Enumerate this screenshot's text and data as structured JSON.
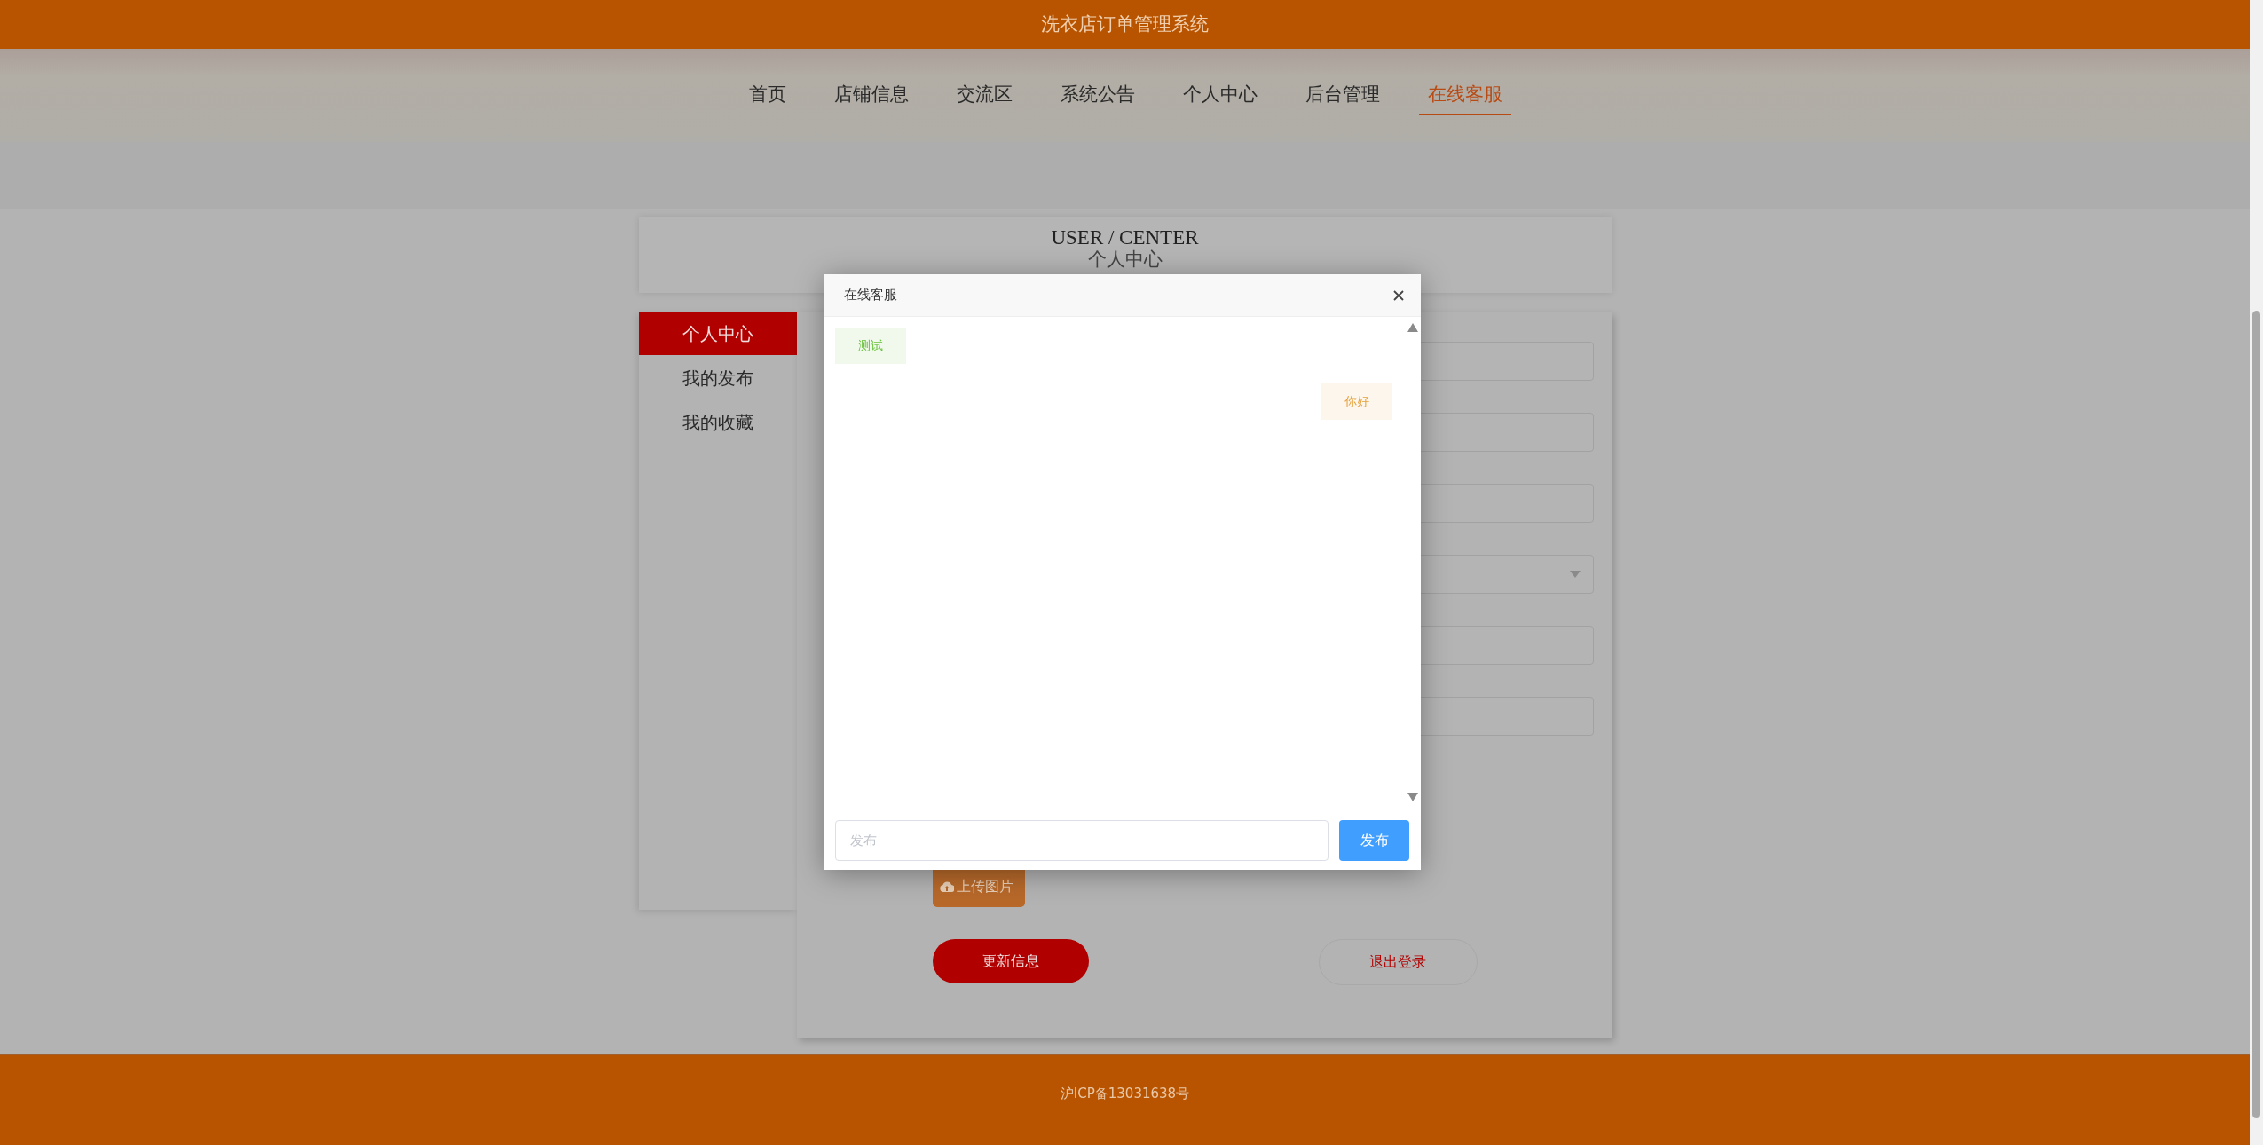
{
  "header": {
    "title": "洗衣店订单管理系统"
  },
  "nav": [
    {
      "label": "首页",
      "selected": false
    },
    {
      "label": "店铺信息",
      "selected": false
    },
    {
      "label": "交流区",
      "selected": false
    },
    {
      "label": "系统公告",
      "selected": false
    },
    {
      "label": "个人中心",
      "selected": false
    },
    {
      "label": "后台管理",
      "selected": false
    },
    {
      "label": "在线客服",
      "selected": true
    }
  ],
  "banner": {
    "title": "USER / CENTER",
    "subtitle": "个人中心"
  },
  "side_menu": [
    {
      "label": "个人中心",
      "selected": true
    },
    {
      "label": "我的发布",
      "selected": false
    },
    {
      "label": "我的收藏",
      "selected": false
    }
  ],
  "form": {
    "fields": [
      {
        "kind": "input"
      },
      {
        "kind": "input"
      },
      {
        "kind": "input"
      },
      {
        "kind": "select"
      },
      {
        "kind": "input"
      },
      {
        "kind": "input"
      }
    ],
    "upload_button": "上传图片",
    "update_button": "更新信息",
    "logout_button": "退出登录"
  },
  "chat_dialog": {
    "title": "在线客服",
    "messages": [
      {
        "kind": "received",
        "text": "测试"
      },
      {
        "kind": "sent",
        "text": "你好"
      }
    ],
    "input": {
      "placeholder": "发布"
    },
    "send_button": "发布"
  },
  "footer": {
    "text": "沪ICP备13031638号"
  }
}
